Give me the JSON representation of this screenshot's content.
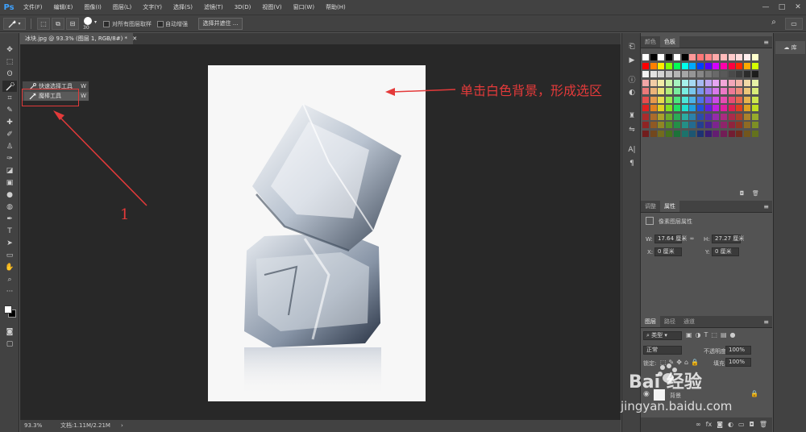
{
  "app": {
    "logo": "Ps",
    "menus": [
      "文件(F)",
      "编辑(E)",
      "图像(I)",
      "图层(L)",
      "文字(Y)",
      "选择(S)",
      "滤镜(T)",
      "3D(D)",
      "视图(V)",
      "窗口(W)",
      "帮助(H)"
    ],
    "window_controls": [
      "—",
      "□",
      "✕"
    ]
  },
  "options": {
    "brush_size": "30",
    "sample_all_layers": "对所有图层取样",
    "auto_enhance": "自动增强",
    "select_and_mask": "选择并遮住 ..."
  },
  "document": {
    "tab_title": "冰块.jpg @ 93.3% (图层 1, RGB/8#) *",
    "zoom": "93.3%",
    "doc_size": "文档:1.11M/2.21M"
  },
  "flyout": {
    "items": [
      {
        "label": "快速选择工具",
        "key": "W"
      },
      {
        "label": "魔棒工具",
        "key": "W"
      }
    ]
  },
  "annotations": {
    "callout": "单击白色背景，形成选区",
    "step": "1",
    "accent": "#e43a3a"
  },
  "panels": {
    "swatch_tabs": [
      "颜色",
      "色板"
    ],
    "props_tabs": [
      "调整",
      "属性"
    ],
    "pixel_layer_props": "像素图层属性",
    "w_label": "W:",
    "w_value": "17.64 厘米",
    "h_label": "H:",
    "h_value": "27.27 厘米",
    "x_label": "X:",
    "x_value": "0 厘米",
    "y_label": "Y:",
    "y_value": "0 厘米",
    "layers_tabs": [
      "图层",
      "路径",
      "通道"
    ],
    "filter_kind": "类型",
    "blend_mode": "正常",
    "opacity_label": "不透明度:",
    "opacity_value": "100%",
    "lock_label": "锁定:",
    "fill_label": "填充:",
    "fill_value": "100%",
    "bg_layer": "背景",
    "library": "库"
  },
  "watermark": {
    "brand": "Bai 经验",
    "url": "jingyan.baidu.com"
  }
}
